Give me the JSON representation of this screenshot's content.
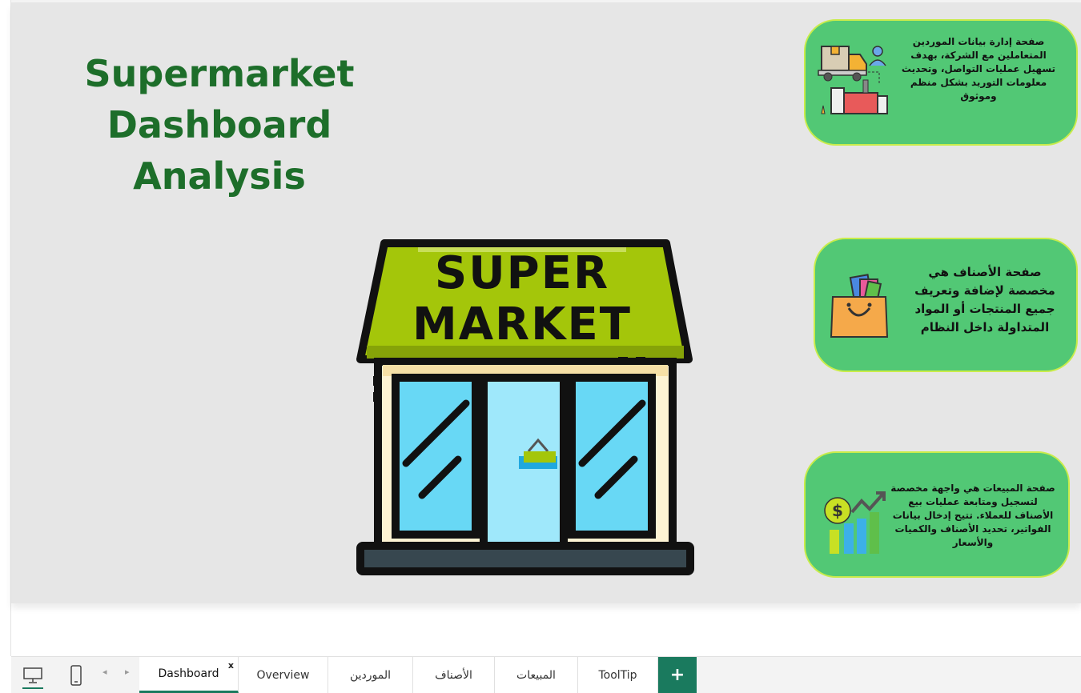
{
  "report": {
    "title_line1": "Supermarket",
    "title_line2": "Dashboard Analysis"
  },
  "store": {
    "sign_line1": "SUPER",
    "sign_line2": "MARKET"
  },
  "cards": {
    "suppliers": {
      "text": "صفحة إدارة بيانات الموردين المتعاملين مع الشركة، بهدف تسهيل عمليات التواصل، وتحديث معلومات التوريد بشكل منظم وموثوق",
      "icon": "supplier-truck-factory-icon"
    },
    "categories": {
      "text": "صفحة الأصناف هي مخصصة لإضافة وتعريف جميع المنتجات أو المواد المتداولة داخل النظام",
      "icon": "shopping-bag-icon"
    },
    "sales": {
      "text": "صفحة المبيعات هي واجهة مخصصة لتسجيل ومتابعة عمليات بيع الأصناف للعملاء. تتيح إدخال بيانات الفواتير، تحديد الأصناف والكميات والأسعار",
      "icon": "sales-growth-chart-icon"
    }
  },
  "tabs": [
    {
      "label": "Dashboard",
      "active": true,
      "close": "x"
    },
    {
      "label": "Overview"
    },
    {
      "label": "الموردين"
    },
    {
      "label": "الأصناف"
    },
    {
      "label": "المبيعات"
    },
    {
      "label": "ToolTip"
    }
  ],
  "tabbar": {
    "add_label": "+",
    "scroll_left": "◂",
    "scroll_right": "▸"
  },
  "colors": {
    "accent": "#1a7a5e",
    "title": "#1d6e2a",
    "card_fill": "#52c875",
    "card_border": "#c9ec4a",
    "awning": "#a4c60a"
  }
}
